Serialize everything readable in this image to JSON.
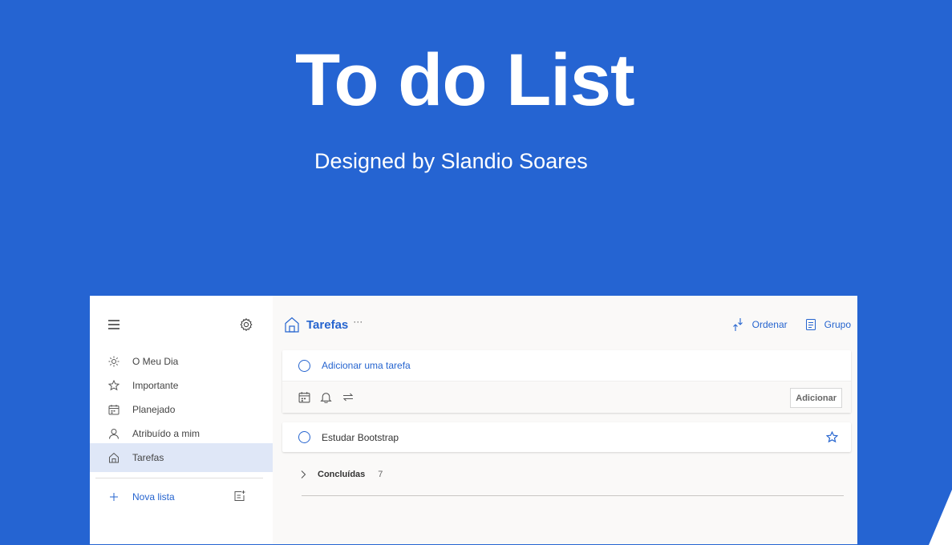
{
  "hero": {
    "title": "To do List",
    "subtitle": "Designed by Slandio Soares"
  },
  "colors": {
    "background": "#2564d2",
    "accent": "#2564cf",
    "active_item": "#dfe7f7"
  },
  "sidebar": {
    "menu_icon": "hamburger-icon",
    "settings_icon": "gear-icon",
    "items": [
      {
        "label": "O Meu Dia",
        "icon": "sun-icon"
      },
      {
        "label": "Importante",
        "icon": "star-icon"
      },
      {
        "label": "Planejado",
        "icon": "calendar-icon"
      },
      {
        "label": "Atribuído a mim",
        "icon": "person-icon"
      },
      {
        "label": "Tarefas",
        "icon": "home-icon",
        "active": true
      }
    ],
    "new_list_label": "Nova lista"
  },
  "main": {
    "title": "Tarefas",
    "more": "···",
    "sort_label": "Ordenar",
    "group_label": "Grupo",
    "add_placeholder": "Adicionar uma tarefa",
    "add_button": "Adicionar",
    "tasks": [
      {
        "label": "Estudar Bootstrap",
        "important": false
      }
    ],
    "completed_label": "Concluídas",
    "completed_count": "7"
  }
}
